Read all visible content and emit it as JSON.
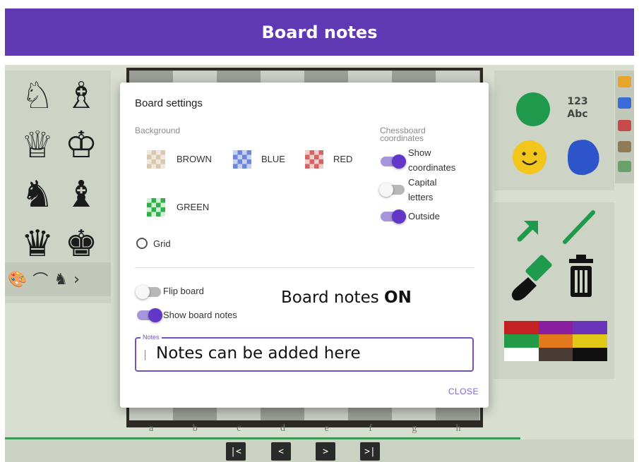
{
  "banner": {
    "title": "Board notes"
  },
  "left_palette": {
    "pieces": [
      "♘",
      "♗",
      "♕",
      "♔",
      "♞",
      "♝",
      "♛",
      "♚"
    ],
    "strip_icons": [
      "palette-icon",
      "hat-icon",
      "knight-icon",
      "chevron-right-icon"
    ],
    "strip_glyphs": [
      "🎨",
      "⌒",
      "♞",
      "›"
    ]
  },
  "board": {
    "files": [
      "a",
      "b",
      "c",
      "d",
      "e",
      "f",
      "g",
      "h"
    ]
  },
  "navigation": {
    "first": "|<",
    "prev": "<",
    "next": ">",
    "last": ">|"
  },
  "right_tools": {
    "text_tool": {
      "line1": "123",
      "line2": "Abc"
    },
    "palette_colors": [
      "#c42124",
      "#8a1ea0",
      "#6a34b8",
      "#239a45",
      "#e07a1a",
      "#e0c816",
      "#ffffff",
      "#4a3b35",
      "#111111"
    ],
    "circle_color": "#1f9a4d",
    "blob_color": "#2d55c9",
    "smiley_color": "#f3c61e",
    "arrow_color": "#1f9a4d"
  },
  "modal": {
    "title": "Board settings",
    "background_label": "Background",
    "backgrounds": [
      {
        "label": "BROWN",
        "light": "#f0e8dc",
        "dark": "#d9c8b0"
      },
      {
        "label": "BLUE",
        "light": "#c7d2f2",
        "dark": "#6e86d8"
      },
      {
        "label": "RED",
        "light": "#f2cccc",
        "dark": "#d26464"
      },
      {
        "label": "GREEN",
        "light": "#d4f0d4",
        "dark": "#2fb04a"
      }
    ],
    "grid_label": "Grid",
    "coordinates_label_1": "Chessboard",
    "coordinates_label_2": "coordinates",
    "show_coordinates": {
      "line1": "Show",
      "line2": "coordinates",
      "on": true
    },
    "capital_letters": {
      "line1": "Capital",
      "line2": "letters",
      "on": false
    },
    "outside": {
      "label": "Outside",
      "on": true
    },
    "flip_board": {
      "label": "Flip board",
      "on": false
    },
    "show_board_notes": {
      "label": "Show board notes",
      "on": true
    },
    "notes_status_prefix": "Board notes ",
    "notes_status_value": "ON",
    "notes_legend": "Notes",
    "notes_value": "Notes can be added here",
    "close_label": "CLOSE"
  }
}
